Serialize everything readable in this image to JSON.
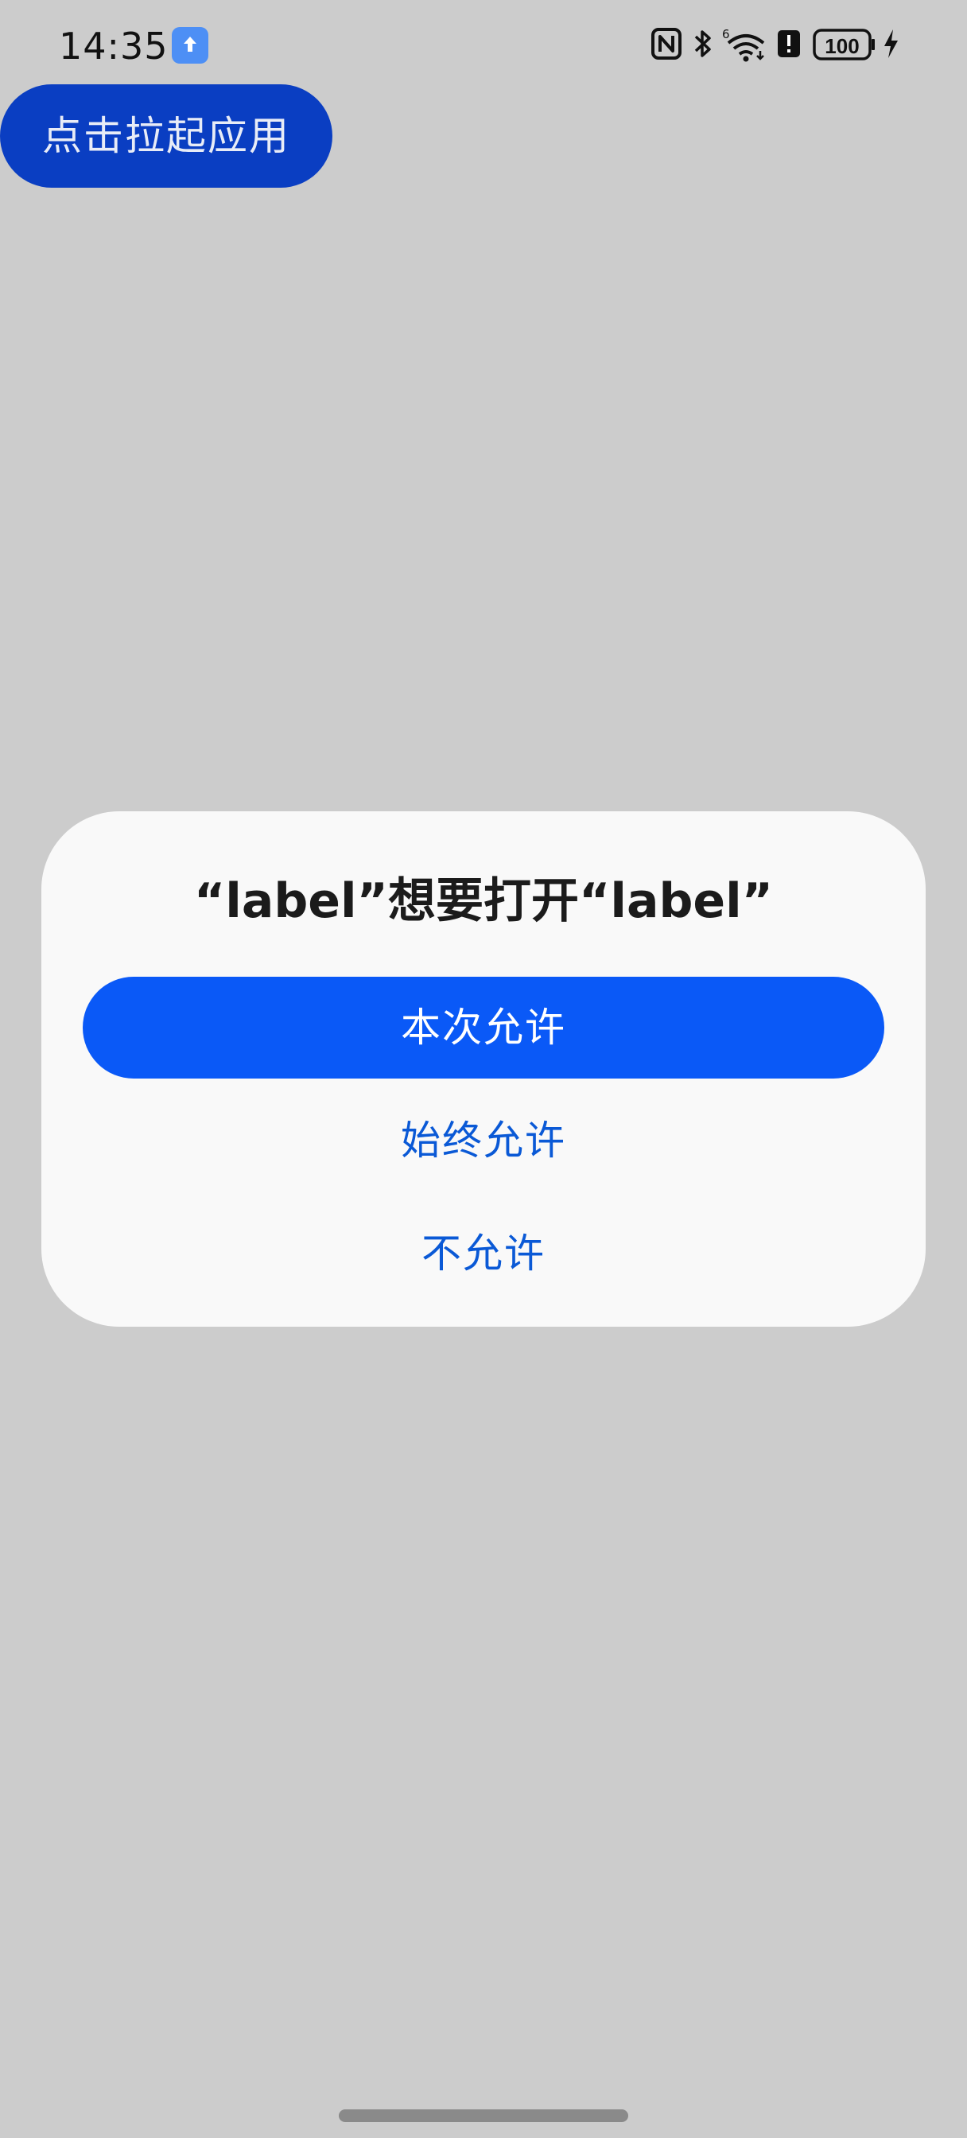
{
  "status_bar": {
    "time": "14:35",
    "battery": "100",
    "icons": [
      "app-notification-icon",
      "nfc-icon",
      "bluetooth-icon",
      "wifi-6-icon",
      "alert-icon",
      "battery-icon",
      "charging-icon"
    ]
  },
  "launch_button": {
    "label": "点击拉起应用"
  },
  "dialog": {
    "title": "“label”想要打开“label”",
    "allow_once": "本次允许",
    "allow_always": "始终允许",
    "deny": "不允许"
  },
  "colors": {
    "overlay": "#cacacb",
    "dialog_bg": "#f9f9f9",
    "primary": "#0a59f7",
    "launch_button": "#0a3ec2",
    "link_text": "#0a59d6"
  }
}
